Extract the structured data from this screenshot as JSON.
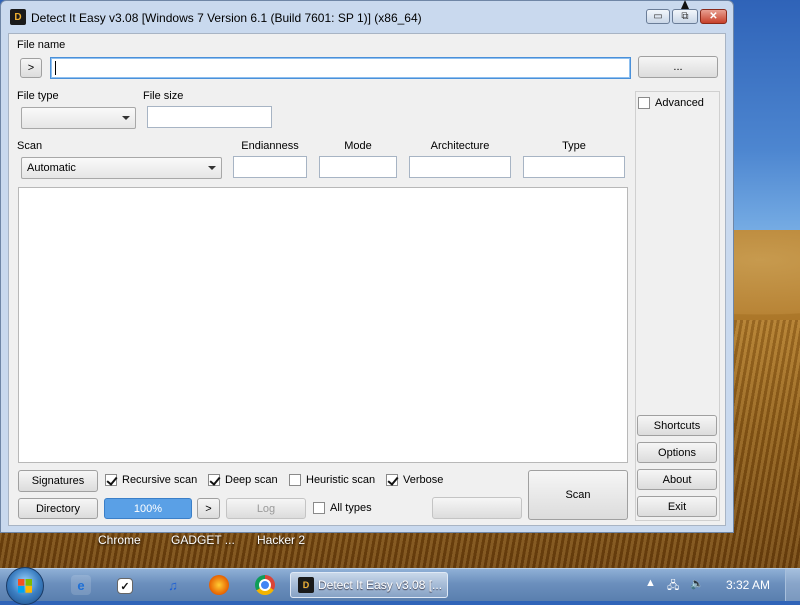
{
  "window": {
    "title": "Detect It Easy v3.08 [Windows 7 Version 6.1 (Build 7601: SP 1)] (x86_64)",
    "icon": "die-logo-icon",
    "controls": {
      "minimize": "▭",
      "restore": "⧉",
      "close": "✕"
    }
  },
  "file": {
    "label": "File name",
    "toggle_label": ">",
    "value": "",
    "browse_label": "..."
  },
  "filetype": {
    "label": "File type",
    "value": ""
  },
  "filesize": {
    "label": "File size",
    "value": ""
  },
  "scan_mode": {
    "label": "Scan",
    "value": "Automatic"
  },
  "fields": {
    "endianness": {
      "label": "Endianness",
      "value": ""
    },
    "mode": {
      "label": "Mode",
      "value": ""
    },
    "architecture": {
      "label": "Architecture",
      "value": ""
    },
    "type": {
      "label": "Type",
      "value": ""
    }
  },
  "advanced": {
    "label": "Advanced",
    "checked": false
  },
  "side_buttons": {
    "shortcuts": "Shortcuts",
    "options": "Options",
    "about": "About",
    "exit": "Exit"
  },
  "bottom": {
    "signatures": "Signatures",
    "directory": "Directory",
    "progress": "100%",
    "next": ">",
    "log": "Log",
    "scan": "Scan",
    "recursive": {
      "label": "Recursive scan",
      "checked": true
    },
    "deep": {
      "label": "Deep scan",
      "checked": true
    },
    "heuristic": {
      "label": "Heuristic scan",
      "checked": false
    },
    "verbose": {
      "label": "Verbose",
      "checked": true
    },
    "alltypes": {
      "label": "All types",
      "checked": false
    }
  },
  "desktop": {
    "labels": [
      "Chrome",
      "GADGET ...",
      "Hacker 2"
    ]
  },
  "taskbar": {
    "active_app": "Detect It Easy v3.08 [...",
    "clock": "3:32 AM",
    "pinned": [
      "internet-explorer-icon",
      "todo-checkbox-icon",
      "itunes-icon",
      "firefox-icon",
      "chrome-icon"
    ]
  }
}
